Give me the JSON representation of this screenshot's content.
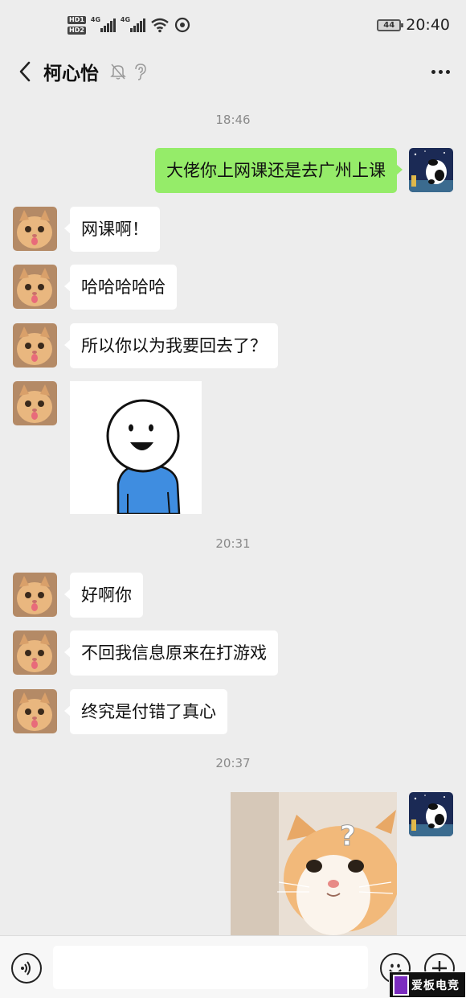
{
  "status_bar": {
    "hd1": "HD",
    "hd1_sub": "1",
    "hd2": "HD",
    "hd2_sub": "2",
    "network1": "4G",
    "network2": "4G",
    "battery": "44",
    "time": "20:40"
  },
  "header": {
    "title": "柯心怡",
    "icons": [
      "back-arrow-icon",
      "mute-bell-icon",
      "ear-icon",
      "more-dots-icon"
    ]
  },
  "messages": {
    "t1": "18:46",
    "m1": "大佬你上网课还是去广州上课",
    "m2": "网课啊！",
    "m3": "哈哈哈哈哈",
    "m4": "所以你以为我要回去了？",
    "t2": "20:31",
    "m5": "好啊你",
    "m6": "不回我信息原来在打游戏",
    "m7": "终究是付错了真心",
    "t3": "20:37",
    "sticker_mark": "?"
  },
  "input_bar": {
    "placeholder": "",
    "icons": [
      "voice-icon",
      "emoji-icon",
      "plus-icon"
    ]
  },
  "watermark": {
    "text": "爱板电竞"
  },
  "colors": {
    "background": "#ededed",
    "my_bubble": "#95ec69",
    "their_bubble": "#ffffff",
    "timestamp": "#8a8a8a"
  }
}
